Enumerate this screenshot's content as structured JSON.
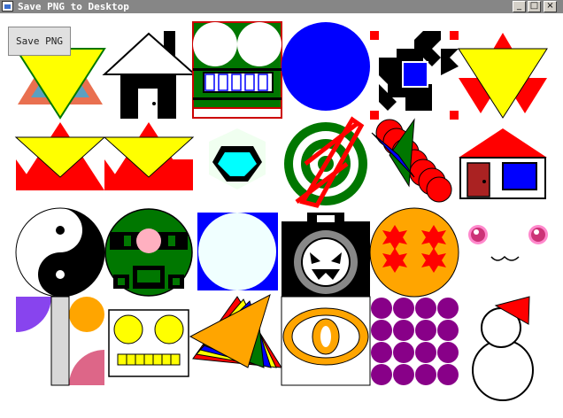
{
  "window": {
    "title": "Save PNG to Desktop",
    "controls": {
      "minimize": "_",
      "maximize": "□",
      "close": "×"
    }
  },
  "toolbar": {
    "save_label": "Save PNG"
  },
  "icons": [
    "warning-triangle-icon",
    "house-icon",
    "robot-face-icon",
    "blue-circle-icon",
    "pixel-maze-icon",
    "yellow-triangle-icon",
    "double-triangle-icon",
    "triangle-pair-icon",
    "cyan-hexagon-icon",
    "target-rings-icon",
    "arrow-cone-icon",
    "red-roof-house-icon",
    "yin-yang-icon",
    "green-robot-icon",
    "light-circle-square-icon",
    "camera-face-icon",
    "dragon-ball-icon",
    "kawaii-face-icon",
    "quarter-circles-icon",
    "yellow-eyes-panel-icon",
    "fanned-triangles-icon",
    "orange-eye-icon",
    "purple-dots-icon",
    "snowman-icon"
  ],
  "colors": {
    "titlebar": "#868686",
    "accent_red": "#ff0000",
    "accent_yellow": "#ffff00",
    "accent_green": "#007700",
    "accent_blue": "#0000ff"
  }
}
